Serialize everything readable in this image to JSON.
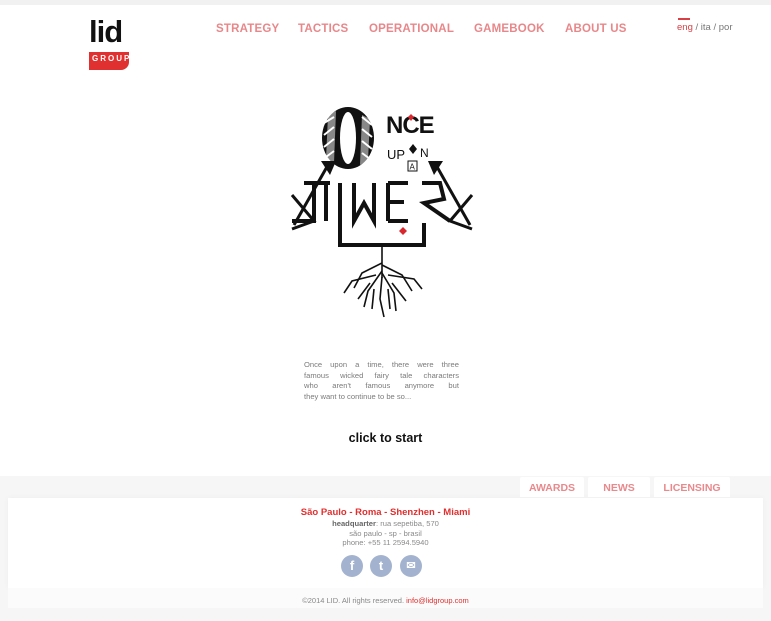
{
  "brand": {
    "logo_text": "lid",
    "logo_sub": "GROUP"
  },
  "nav": {
    "items": [
      "STRATEGY",
      "TACTICS",
      "OPERATIONAL",
      "GAMEBOOK",
      "ABOUT US"
    ]
  },
  "lang": {
    "active": "eng",
    "sep1": " / ",
    "ita": "ita",
    "sep2": " / ",
    "por": "por"
  },
  "artwork": {
    "line1": "NCE",
    "line2": "UP",
    "line2b": "N",
    "line3": "A",
    "line4": "TIME"
  },
  "description": {
    "lines": [
      "Once upon a time, there were three",
      "famous wicked fairy tale characters",
      "who aren't famous anymore but",
      "they want to continue to be so..."
    ]
  },
  "cta": "click to start",
  "footer": {
    "tabs": [
      "AWARDS",
      "NEWS",
      "LICENSING"
    ],
    "cities": "São Paulo - Roma - Shenzhen - Miami",
    "hq_label": "headquarter",
    "hq_value": ": rua sepetiba, 570",
    "city_line": "são paulo - sp - brasil",
    "phone": "phone: +55 11 2594.5940",
    "social": [
      {
        "icon": "facebook-icon",
        "glyph": "f"
      },
      {
        "icon": "twitter-icon",
        "glyph": "t"
      },
      {
        "icon": "email-icon",
        "glyph": "✉"
      }
    ],
    "copyright": "©2014 LID. All rights reserved. ",
    "email": "info@lidgroup.com"
  }
}
